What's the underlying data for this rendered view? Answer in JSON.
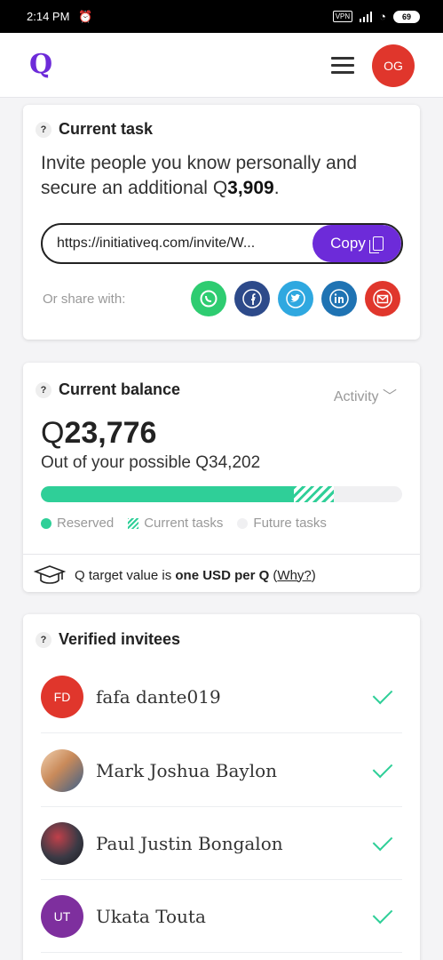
{
  "status_bar": {
    "time": "2:14 PM",
    "vpn": "VPN",
    "battery": "69"
  },
  "header": {
    "logo": "Q",
    "avatar_initials": "OG",
    "avatar_color": "#e0362c"
  },
  "current_task": {
    "help": "?",
    "title": "Current task",
    "text_prefix": "Invite people you know personally and secure an additional ",
    "q_symbol": "Q",
    "amount": "3,909",
    "text_suffix": ".",
    "invite_url": "https://initiativeq.com/invite/W...",
    "copy_label": "Copy",
    "share_label": "Or share with:",
    "share_icons": [
      {
        "name": "whatsapp-icon",
        "glyph": "◯",
        "color": "#2ecc71"
      },
      {
        "name": "facebook-icon",
        "glyph": "f",
        "color": "#2d4a8a"
      },
      {
        "name": "twitter-icon",
        "glyph": "t",
        "color": "#2fa8e0"
      },
      {
        "name": "linkedin-icon",
        "glyph": "in",
        "color": "#1f73b3"
      },
      {
        "name": "email-icon",
        "glyph": "✉",
        "color": "#e0362c"
      }
    ]
  },
  "current_balance": {
    "help": "?",
    "title": "Current balance",
    "activity": "Activity ﹀",
    "q_symbol": "Q",
    "balance": "23,776",
    "possible_text": "Out of your possible Q34,202",
    "progress": {
      "reserved_fraction": 0.7,
      "current_tasks_fraction": 0.11
    },
    "legend": {
      "reserved": "Reserved",
      "current_tasks": "Current tasks",
      "future_tasks": "Future tasks"
    },
    "target_text_prefix": "Q target value is ",
    "target_bold": "one USD per Q",
    "target_link_open": " (",
    "target_link": "Why?",
    "target_link_close": ")"
  },
  "verified_invitees": {
    "help": "?",
    "title": "Verified invitees",
    "items": [
      {
        "initials": "FD",
        "name": "fafa dante019",
        "color": "#e0362c"
      },
      {
        "initials": "",
        "name": "Mark Joshua Baylon",
        "color": "#c98a5a"
      },
      {
        "initials": "",
        "name": "Paul Justin Bongalon",
        "color": "#3a3a45"
      },
      {
        "initials": "UT",
        "name": "Ukata Touta",
        "color": "#7e2f9e"
      }
    ]
  }
}
